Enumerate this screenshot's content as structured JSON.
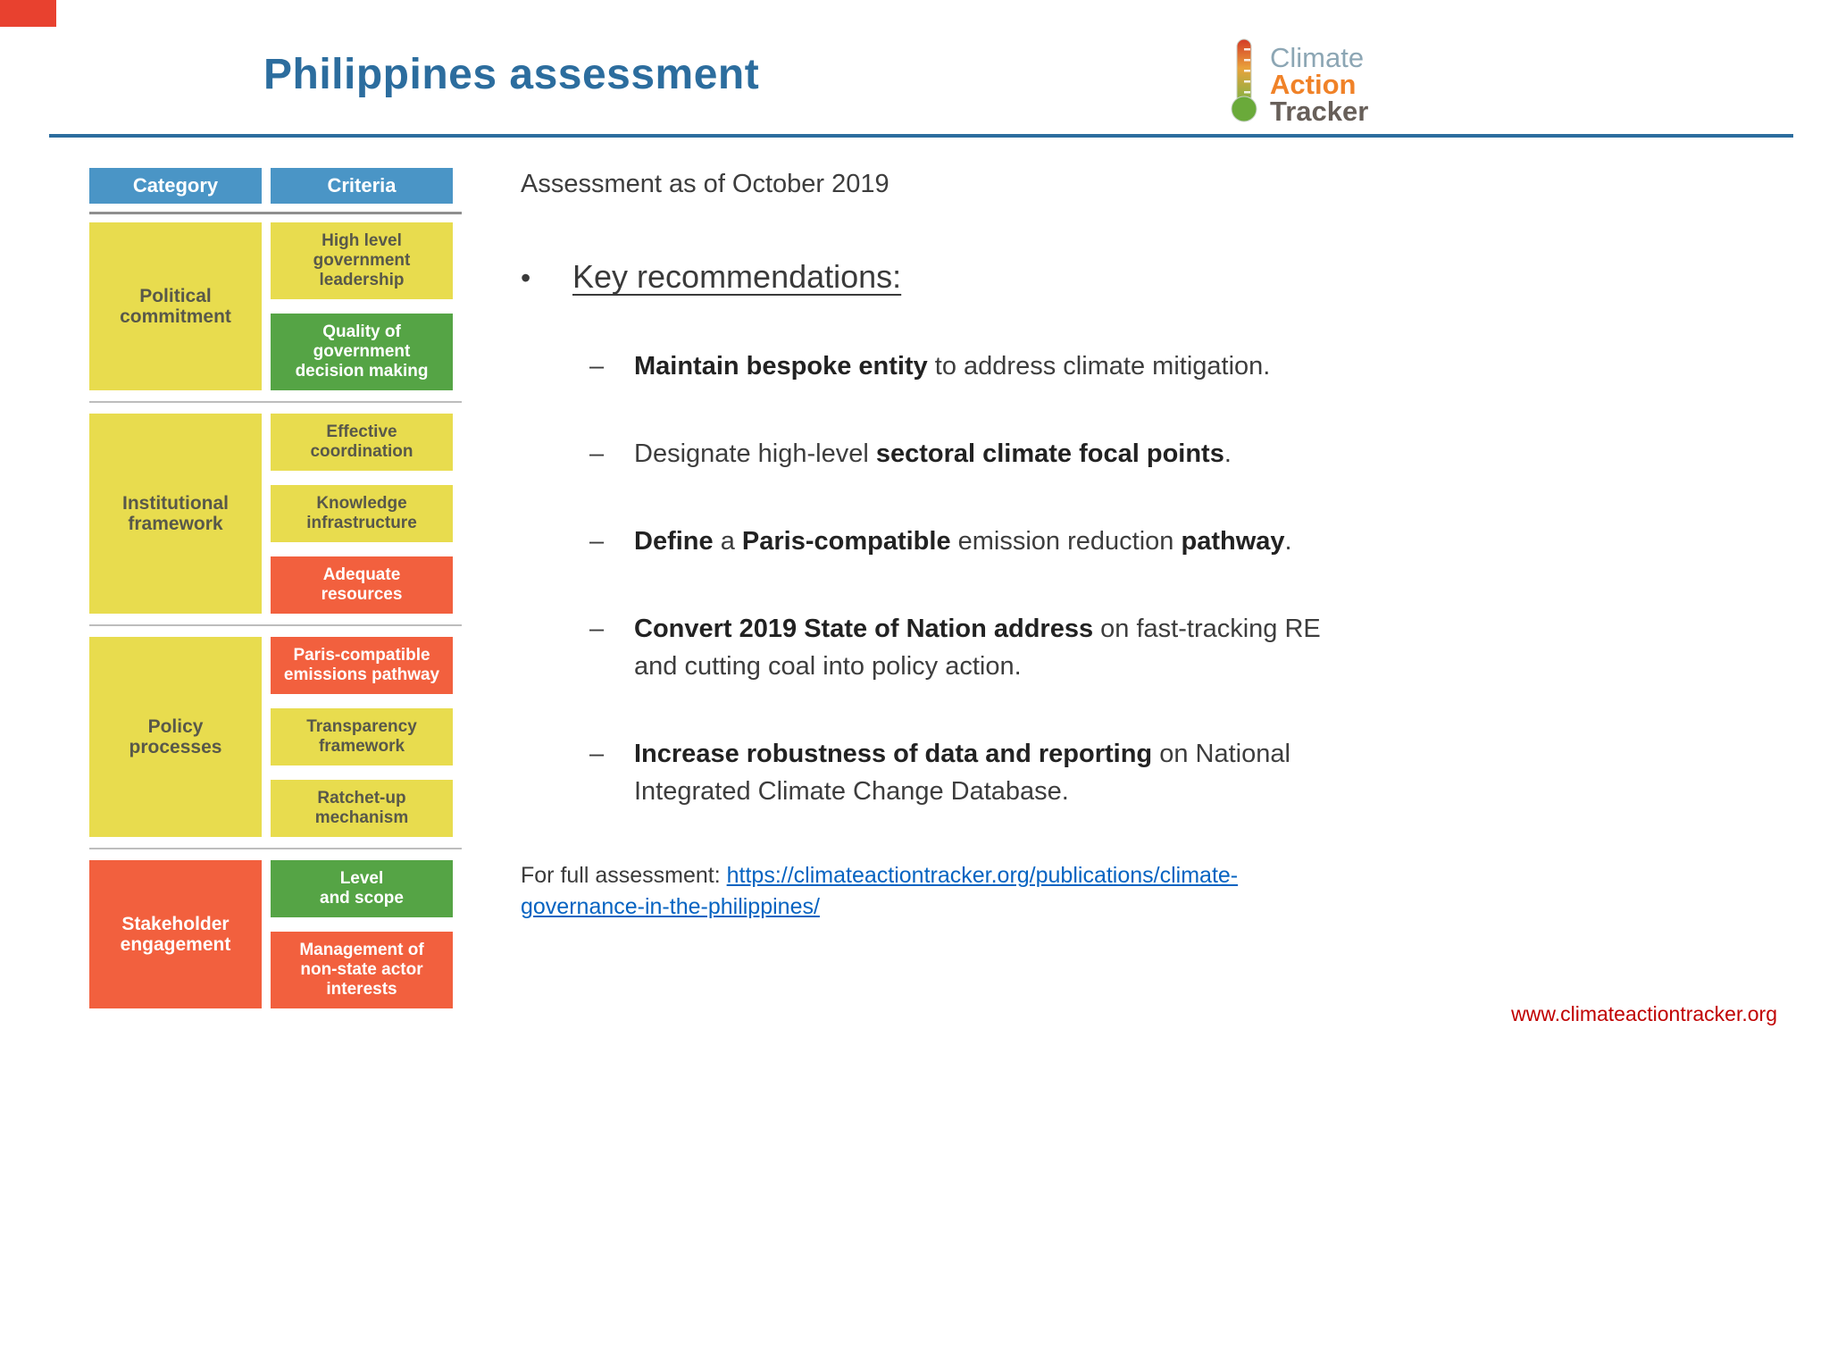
{
  "colors": {
    "yellow": "#e8dc4e",
    "green": "#55a445",
    "red": "#f2603e",
    "header_blue": "#4a95c6",
    "title_blue": "#2c6d9e",
    "link_blue": "#0563c1",
    "footer_red": "#c00000",
    "corner_red": "#e8412f",
    "logo_climate": "#8ca6b4",
    "logo_action": "#f08228",
    "logo_tracker": "#675f59"
  },
  "slide": {
    "title": "Philippines assessment",
    "assessment_date": "Assessment as of October 2019",
    "footer_url": "www.climateactiontracker.org"
  },
  "logo": {
    "line1": "Climate",
    "line2": "Action",
    "line3": "Tracker",
    "icon": "thermometer-icon"
  },
  "table": {
    "headers": {
      "category": "Category",
      "criteria": "Criteria"
    },
    "groups": [
      {
        "category": "Political\ncommitment",
        "category_color": "yellow",
        "criteria": [
          {
            "label": "High level\ngovernment\nleadership",
            "color": "yellow"
          },
          {
            "label": "Quality of\ngovernment\ndecision making",
            "color": "green"
          }
        ]
      },
      {
        "category": "Institutional\nframework",
        "category_color": "yellow",
        "criteria": [
          {
            "label": "Effective\ncoordination",
            "color": "yellow"
          },
          {
            "label": "Knowledge\ninfrastructure",
            "color": "yellow"
          },
          {
            "label": "Adequate\nresources",
            "color": "red"
          }
        ]
      },
      {
        "category": "Policy\nprocesses",
        "category_color": "yellow",
        "criteria": [
          {
            "label": "Paris-compatible\nemissions pathway",
            "color": "red"
          },
          {
            "label": "Transparency\nframework",
            "color": "yellow"
          },
          {
            "label": "Ratchet-up\nmechanism",
            "color": "yellow"
          }
        ]
      },
      {
        "category": "Stakeholder\nengagement",
        "category_color": "red",
        "criteria": [
          {
            "label": "Level\nand scope",
            "color": "green"
          },
          {
            "label": "Management of\nnon-state actor\ninterests",
            "color": "red"
          }
        ]
      }
    ]
  },
  "recommendations": {
    "bullet": "•",
    "dash": "–",
    "heading": "Key recommendations:",
    "items": [
      {
        "parts": [
          {
            "text": "Maintain bespoke entity",
            "bold": true
          },
          {
            "text": " to address climate mitigation.",
            "bold": false
          }
        ]
      },
      {
        "parts": [
          {
            "text": "Designate high-level ",
            "bold": false
          },
          {
            "text": "sectoral climate focal points",
            "bold": true
          },
          {
            "text": ".",
            "bold": false
          }
        ]
      },
      {
        "parts": [
          {
            "text": "Define",
            "bold": true
          },
          {
            "text": " a ",
            "bold": false
          },
          {
            "text": "Paris-compatible",
            "bold": true
          },
          {
            "text": " emission reduction ",
            "bold": false
          },
          {
            "text": "pathway",
            "bold": true
          },
          {
            "text": ".",
            "bold": false
          }
        ]
      },
      {
        "parts": [
          {
            "text": "Convert 2019 State of Nation address",
            "bold": true
          },
          {
            "text": " on fast-tracking RE and cutting coal into policy action.",
            "bold": false
          }
        ]
      },
      {
        "parts": [
          {
            "text": "Increase robustness of data and reporting",
            "bold": true
          },
          {
            "text": " on National Integrated Climate Change Database.",
            "bold": false
          }
        ]
      }
    ]
  },
  "full_assessment": {
    "prefix": "For full assessment: ",
    "link": "https://climateactiontracker.org/publications/climate-governance-in-the-philippines/"
  }
}
